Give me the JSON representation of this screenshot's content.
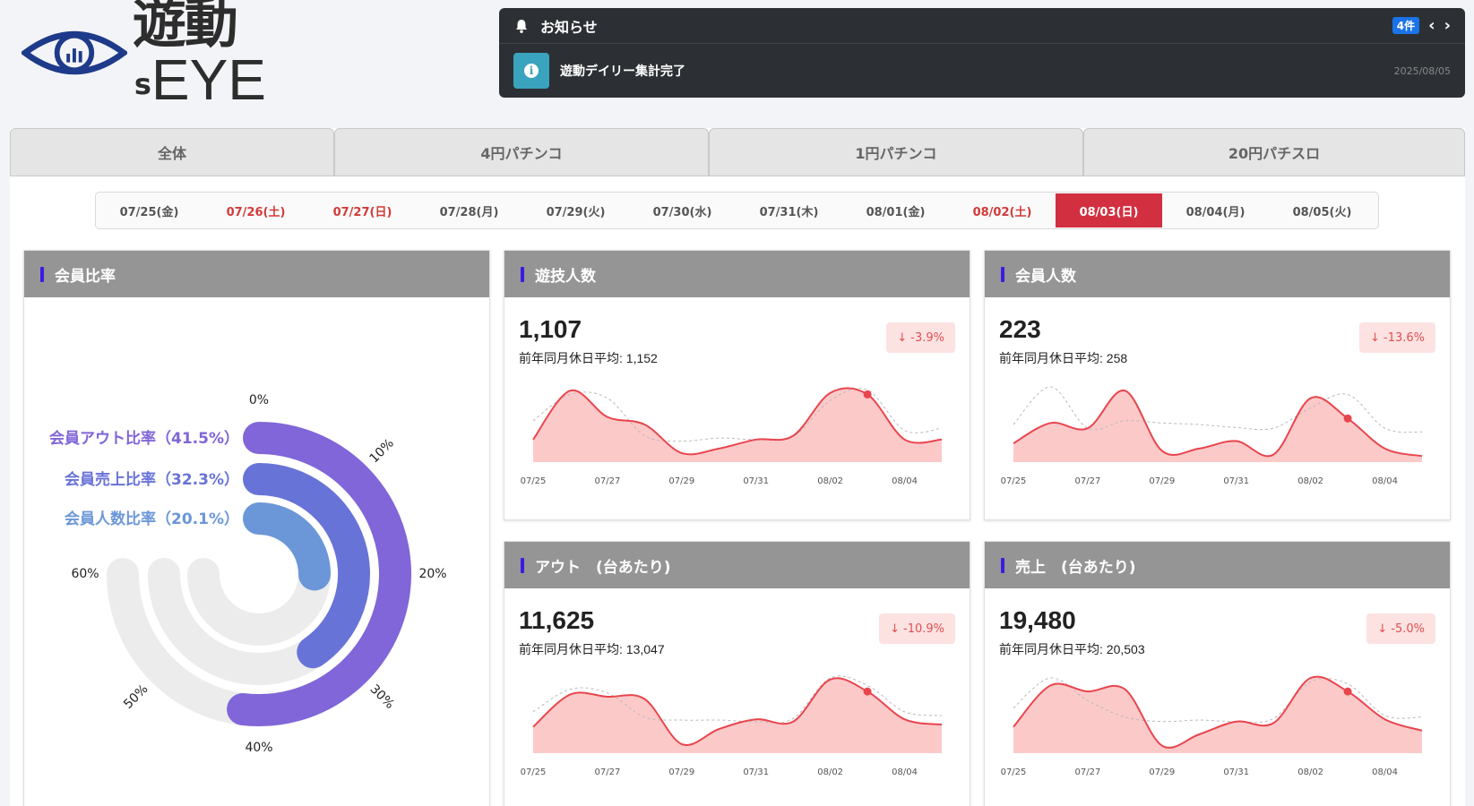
{
  "header": {
    "logo_text": "遊動",
    "logo_s": "s",
    "logo_eye": "EYE"
  },
  "notice": {
    "title": "お知らせ",
    "count_badge": "4件",
    "message": "遊動デイリー集計完了",
    "date": "2025/08/05"
  },
  "tabs": [
    {
      "label": "全体",
      "active": true
    },
    {
      "label": "4円パチンコ",
      "active": false
    },
    {
      "label": "1円パチンコ",
      "active": false
    },
    {
      "label": "20円パチスロ",
      "active": false
    }
  ],
  "dates": [
    {
      "label": "07/25(金)",
      "type": "normal"
    },
    {
      "label": "07/26(土)",
      "type": "red"
    },
    {
      "label": "07/27(日)",
      "type": "red"
    },
    {
      "label": "07/28(月)",
      "type": "normal"
    },
    {
      "label": "07/29(火)",
      "type": "normal"
    },
    {
      "label": "07/30(水)",
      "type": "normal"
    },
    {
      "label": "07/31(木)",
      "type": "normal"
    },
    {
      "label": "08/01(金)",
      "type": "normal"
    },
    {
      "label": "08/02(土)",
      "type": "red"
    },
    {
      "label": "08/03(日)",
      "type": "active"
    },
    {
      "label": "08/04(月)",
      "type": "normal"
    },
    {
      "label": "08/05(火)",
      "type": "normal"
    }
  ],
  "ratio_card": {
    "title": "会員比率",
    "series": [
      {
        "name": "会員アウト比率（41.5%）",
        "value": 41.5,
        "color": "#8066d8"
      },
      {
        "name": "会員売上比率（32.3%）",
        "value": 32.3,
        "color": "#6873d8"
      },
      {
        "name": "会員人数比率（20.1%）",
        "value": 20.1,
        "color": "#6b97d8"
      }
    ],
    "axis_ticks": [
      "0%",
      "10%",
      "20%",
      "30%",
      "40%",
      "50%",
      "60%"
    ],
    "track_color": "#ececec"
  },
  "metrics": {
    "visitors": {
      "title": "遊技人数",
      "value": "1,107",
      "sub_label": "前年同月休日平均: ",
      "sub_value": "1,152",
      "delta": "-3.9%",
      "series": [
        0.3,
        0.95,
        0.6,
        0.5,
        0.12,
        0.18,
        0.3,
        0.35,
        0.92,
        0.9,
        0.3,
        0.3
      ],
      "prev": [
        0.55,
        0.9,
        0.85,
        0.35,
        0.28,
        0.32,
        0.3,
        0.34,
        0.82,
        0.96,
        0.42,
        0.45
      ],
      "highlight_index": 9
    },
    "members": {
      "title": "会員人数",
      "value": "223",
      "sub_label": "前年同月休日平均: ",
      "sub_value": "258",
      "delta": "-13.6%",
      "series": [
        0.25,
        0.52,
        0.45,
        0.95,
        0.15,
        0.18,
        0.28,
        0.1,
        0.85,
        0.58,
        0.18,
        0.08
      ],
      "prev": [
        0.5,
        1.0,
        0.45,
        0.55,
        0.52,
        0.5,
        0.46,
        0.45,
        0.72,
        0.9,
        0.45,
        0.4
      ],
      "highlight_index": 9
    },
    "out": {
      "title": "アウト　(台あたり)",
      "value": "11,625",
      "sub_label": "前年同月休日平均: ",
      "sub_value": "13,047",
      "delta": "-10.9%",
      "series": [
        0.35,
        0.78,
        0.75,
        0.72,
        0.12,
        0.32,
        0.45,
        0.42,
        0.98,
        0.82,
        0.45,
        0.38
      ],
      "prev": [
        0.55,
        0.85,
        0.8,
        0.48,
        0.44,
        0.44,
        0.42,
        0.46,
        1.0,
        0.9,
        0.55,
        0.5
      ],
      "highlight_index": 9
    },
    "sales": {
      "title": "売上　(台あたり)",
      "value": "19,480",
      "sub_label": "前年同月休日平均: ",
      "sub_value": "20,503",
      "delta": "-5.0%",
      "series": [
        0.35,
        0.9,
        0.82,
        0.85,
        0.1,
        0.25,
        0.42,
        0.4,
        1.0,
        0.82,
        0.45,
        0.3
      ],
      "prev": [
        0.6,
        1.0,
        0.7,
        0.48,
        0.42,
        0.44,
        0.42,
        0.46,
        0.95,
        0.92,
        0.5,
        0.48
      ],
      "highlight_index": 9
    }
  },
  "spark_x_labels": [
    "07/25",
    "07/27",
    "07/29",
    "07/31",
    "08/02",
    "08/04"
  ],
  "colors": {
    "accent": "#3b8ff5",
    "active_date": "#d23040",
    "spark_line": "#e8454d",
    "spark_fill": "#fcc9c9"
  }
}
